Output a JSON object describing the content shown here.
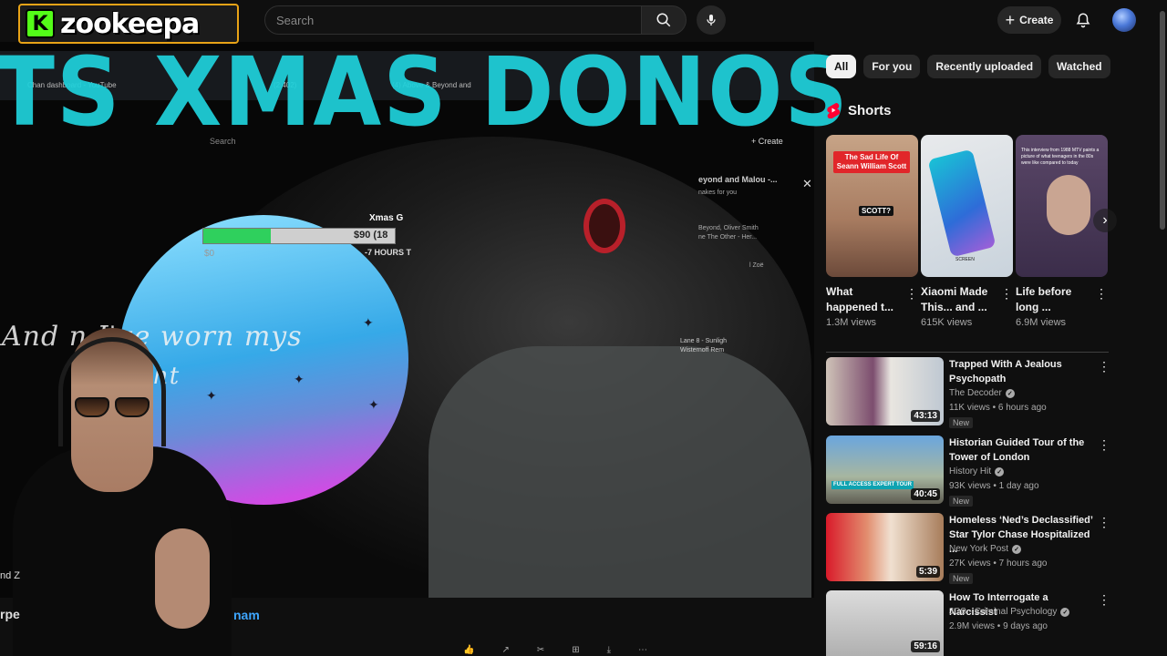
{
  "header": {
    "logo_text": "zookeepa",
    "logo_mark": "K",
    "search_placeholder": "Search",
    "create_label": "Create"
  },
  "video": {
    "overlay_title": "TS XMAS DONOS",
    "lyrics": "And     n I've worn mys",
    "lyrics_cont": "ht",
    "goal_label": "Xmas G",
    "goal_amount": "$90 (18",
    "goal_hours": "-7 HOURS T",
    "goal_zero": "$0",
    "goal_progress": 0.35,
    "inner_search": "Search",
    "inner_create": "+ Create",
    "inner_side_title": "eyond and Malou -...",
    "inner_side_sub": "nakes for you",
    "inner_side_item": "Beyond, Oliver Smith\nne The Other - Her...",
    "inner_zoe": "l Zoë",
    "inner_lane": "Lane 8 - Sunligh\nWisternoff Rem",
    "inner_tabs": [
      "Chan dashboard - YouTube",
      "(2,402)",
      "(4) Above & Beyond and"
    ],
    "channel_snippet": "nam",
    "left_snip_1": "nd Z",
    "left_snip_2": "rpe"
  },
  "filters": [
    "All",
    "For you",
    "Recently uploaded",
    "Watched"
  ],
  "shorts": {
    "heading": "Shorts",
    "items": [
      {
        "title": "What happened t...",
        "views": "1.3M views",
        "caption": "The Sad Life Of Seann William Scott",
        "tag": "SCOTT?"
      },
      {
        "title": "Xiaomi Made This... and ...",
        "views": "615K views",
        "caption": "SCREEN"
      },
      {
        "title": "Life before long ...",
        "views": "6.9M views",
        "caption": "This interview from 1988 MTV paints a picture of what teenagers in the 80s were like compared to today"
      }
    ]
  },
  "videos": [
    {
      "title": "Trapped With A Jealous Psychopath",
      "channel": "The Decoder",
      "meta": "11K views • 6 hours ago",
      "badge": "New",
      "duration": "43:13"
    },
    {
      "title": "Historian Guided Tour of the Tower of London",
      "channel": "History Hit",
      "meta": "93K views • 1 day ago",
      "badge": "New",
      "duration": "40:45",
      "thumb_tag": "FULL ACCESS EXPERT TOUR"
    },
    {
      "title": "Homeless ‘Ned’s Declassified’ Star Tylor Chase Hospitalized ...",
      "channel": "New York Post",
      "meta": "27K views • 7 hours ago",
      "badge": "New",
      "duration": "5:39"
    },
    {
      "title": "How To Interrogate a Narcissist",
      "channel": "JCS - Criminal Psychology",
      "meta": "2.9M views • 9 days ago",
      "duration": "59:16"
    }
  ],
  "colors": {
    "background": "#0f0f0f",
    "overlay_title": "#1fd2dc",
    "logo_accent": "#53fc18",
    "progress_fill": "#2fd05d",
    "link": "#3ea6ff"
  }
}
